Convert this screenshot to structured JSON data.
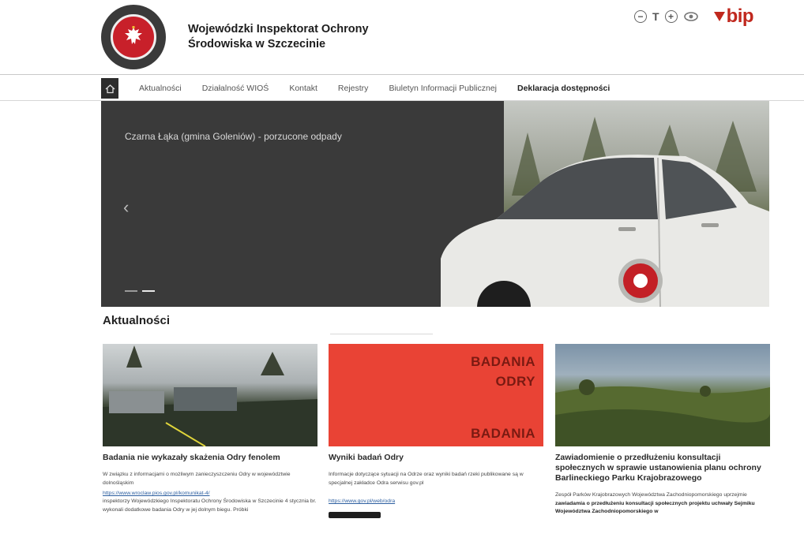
{
  "header": {
    "org_name_line1": "Wojewódzki Inspektorat Ochrony",
    "org_name_line2": "Środowiska w Szczecinie",
    "utilities": {
      "font_decrease": "−",
      "font_label": "T",
      "font_increase": "+",
      "bip_label": "bip"
    }
  },
  "nav": {
    "items": [
      {
        "label": "Aktualności"
      },
      {
        "label": "Działalność WIOŚ"
      },
      {
        "label": "Kontakt"
      },
      {
        "label": "Rejestry"
      },
      {
        "label": "Biuletyn Informacji Publicznej"
      },
      {
        "label": "Deklaracja dostępności"
      }
    ]
  },
  "hero": {
    "caption": "Czarna Łąka (gmina Goleniów) - porzucone odpady",
    "prev_arrow": "‹",
    "slide_count": 2,
    "active_slide": 1
  },
  "news": {
    "section_title": "Aktualności",
    "cards": [
      {
        "title": "Badania nie wykazały skażenia Odry fenolem",
        "text": "W związku z informacjami o możliwym zanieczyszczeniu Odry w województwie dolnośląskim",
        "link": "https://www.wroclaw.pios.gov.pl/komunikat-4/",
        "text2": "inspektorzy Wojewódzkiego Inspektoratu Ochrony Środowiska w Szczecinie 4 stycznia br. wykonali dodatkowe badania Odry w jej dolnym biegu. Próbki"
      },
      {
        "title": "Wyniki badań Odry",
        "text": "Informacje dotyczące sytuacji na Odrze oraz wyniki badań rzeki publikowane są w specjalnej zakładce Odra serwisu gov.pl",
        "link": "https://www.gov.pl/web/odra",
        "image_text_top_1": "BADANIA",
        "image_text_top_2": "ODRY",
        "image_text_bottom": "BADANIA"
      },
      {
        "title": "Zawiadomienie o przedłużeniu konsultacji społecznych w sprawie ustanowienia planu ochrony Barlineckiego Parku Krajobrazowego",
        "text": "Zespół Parków Krajobrazowych Województwa Zachodniopomorskiego uprzejmie",
        "text_bold": "zawiadamia o przedłużeniu konsultacji społecznych projektu uchwały Sejmiku Województwa Zachodniopomorskiego w"
      }
    ]
  },
  "colors": {
    "accent_red": "#c0281e",
    "nav_dark": "#2c2c2c",
    "link_blue": "#2d5fa0"
  }
}
